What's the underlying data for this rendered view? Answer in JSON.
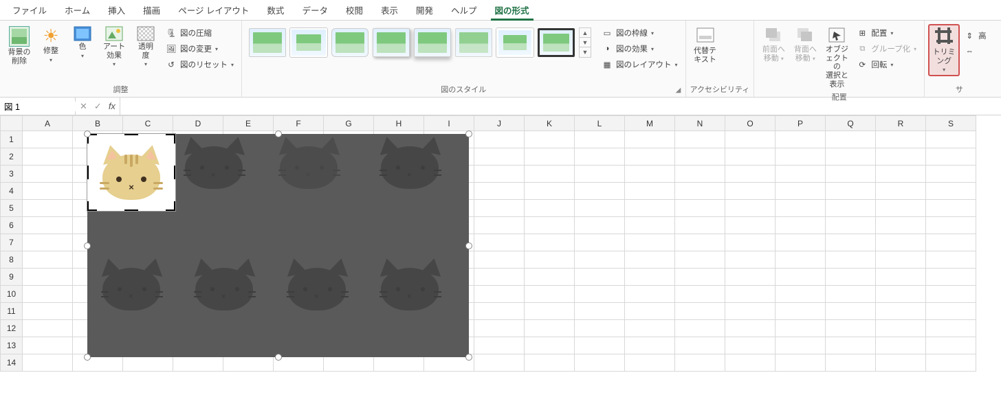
{
  "tabs": {
    "file": "ファイル",
    "home": "ホーム",
    "insert": "挿入",
    "draw": "描画",
    "pagelayout": "ページ レイアウト",
    "formulas": "数式",
    "data": "データ",
    "review": "校閲",
    "view": "表示",
    "developer": "開発",
    "help": "ヘルプ",
    "pictureformat": "図の形式"
  },
  "ribbon": {
    "adjust": {
      "removebg": "背景の\n削除",
      "corrections": "修整",
      "color": "色",
      "artistic": "アート効果",
      "transparency": "透明\n度",
      "compress": "図の圧縮",
      "change": "図の変更",
      "reset": "図のリセット",
      "label": "調整"
    },
    "styles": {
      "border": "図の枠線",
      "effects": "図の効果",
      "layout": "図のレイアウト",
      "label": "図のスタイル"
    },
    "acc": {
      "alttext": "代替テ\nキスト",
      "label": "アクセシビリティ"
    },
    "arrange": {
      "front": "前面へ\n移動",
      "back": "背面へ\n移動",
      "selpane": "オブジェクトの\n選択と表示",
      "align": "配置",
      "group": "グループ化",
      "rotate": "回転",
      "label": "配置"
    },
    "size": {
      "crop": "トリミング",
      "h": "高",
      "label": "サ"
    }
  },
  "namebox": "図 1",
  "columns": [
    "A",
    "B",
    "C",
    "D",
    "E",
    "F",
    "G",
    "H",
    "I",
    "J",
    "K",
    "L",
    "M",
    "N",
    "O",
    "P",
    "Q",
    "R",
    "S"
  ],
  "rows": [
    "1",
    "2",
    "3",
    "4",
    "5",
    "6",
    "7",
    "8",
    "9",
    "10",
    "11",
    "12",
    "13",
    "14"
  ]
}
